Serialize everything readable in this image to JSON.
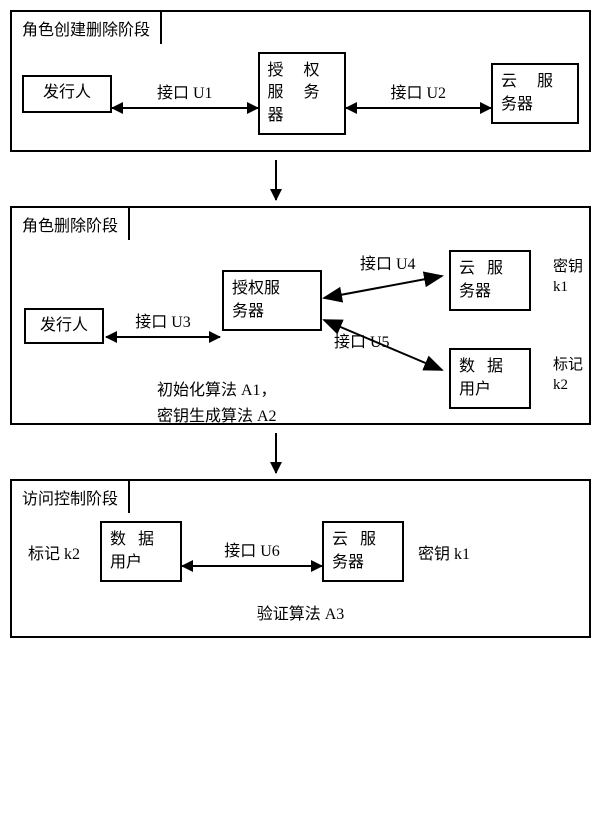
{
  "stage1": {
    "title": "角色创建删除阶段",
    "issuer": "发行人",
    "auth_server": "授 权 服 务 器",
    "cloud_server": "云 服 务器",
    "u1": "接口 U1",
    "u2": "接口 U2"
  },
  "stage2": {
    "title": "角色删除阶段",
    "issuer": "发行人",
    "auth_server": "授权服务器",
    "cloud_server": "云 服 务器",
    "data_user": "数 据 用户",
    "u3": "接口 U3",
    "u4": "接口 U4",
    "u5": "接口 U5",
    "note_line1": "初始化算法 A1，",
    "note_line2": "密钥生成算法 A2",
    "key_k1": "密钥 k1",
    "mark_k2": "标记 k2"
  },
  "stage3": {
    "title": "访问控制阶段",
    "data_user": "数 据 用户",
    "cloud_server": "云 服 务器",
    "u6": "接口 U6",
    "mark_k2": "标记 k2",
    "key_k1": "密钥 k1",
    "verify_algo": "验证算法 A3"
  }
}
